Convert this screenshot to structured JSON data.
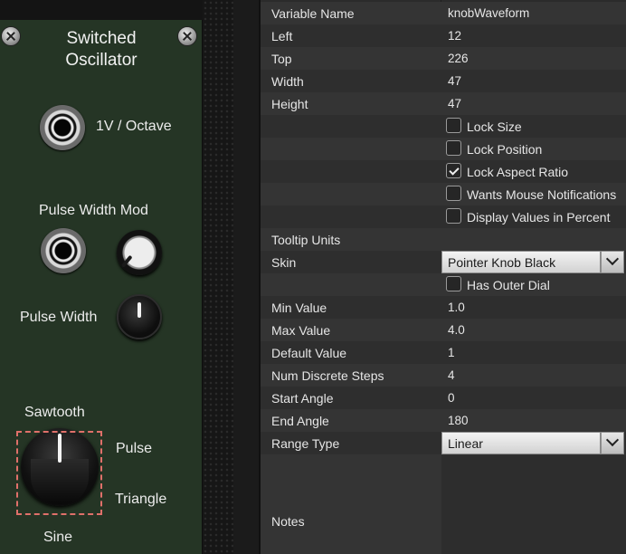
{
  "module": {
    "title_line1": "Switched",
    "title_line2": "Oscillator",
    "labels": {
      "v_per_octave": "1V / Octave",
      "pulse_width_mod": "Pulse Width Mod",
      "pulse_width": "Pulse Width",
      "sawtooth": "Sawtooth",
      "pulse": "Pulse",
      "triangle": "Triangle",
      "sine": "Sine"
    }
  },
  "properties": {
    "variable_name": {
      "label": "Variable Name",
      "value": "knobWaveform"
    },
    "left": {
      "label": "Left",
      "value": "12"
    },
    "top": {
      "label": "Top",
      "value": "226"
    },
    "width": {
      "label": "Width",
      "value": "47"
    },
    "height": {
      "label": "Height",
      "value": "47"
    },
    "lock_size": {
      "label": "Lock Size",
      "checked": false
    },
    "lock_position": {
      "label": "Lock Position",
      "checked": false
    },
    "lock_aspect_ratio": {
      "label": "Lock Aspect Ratio",
      "checked": true
    },
    "wants_mouse_notifications": {
      "label": "Wants Mouse Notifications",
      "checked": false
    },
    "display_values_in_percent": {
      "label": "Display Values in Percent",
      "checked": false
    },
    "tooltip_units": {
      "label": "Tooltip Units",
      "value": ""
    },
    "skin": {
      "label": "Skin",
      "value": "Pointer Knob Black"
    },
    "has_outer_dial": {
      "label": "Has Outer Dial",
      "checked": false
    },
    "min_value": {
      "label": "Min Value",
      "value": "1.0"
    },
    "max_value": {
      "label": "Max Value",
      "value": "4.0"
    },
    "default_value": {
      "label": "Default Value",
      "value": "1"
    },
    "num_discrete_steps": {
      "label": "Num Discrete Steps",
      "value": "4"
    },
    "start_angle": {
      "label": "Start Angle",
      "value": "0"
    },
    "end_angle": {
      "label": "End Angle",
      "value": "180"
    },
    "range_type": {
      "label": "Range Type",
      "value": "Linear"
    },
    "notes": {
      "label": "Notes",
      "value": ""
    }
  }
}
